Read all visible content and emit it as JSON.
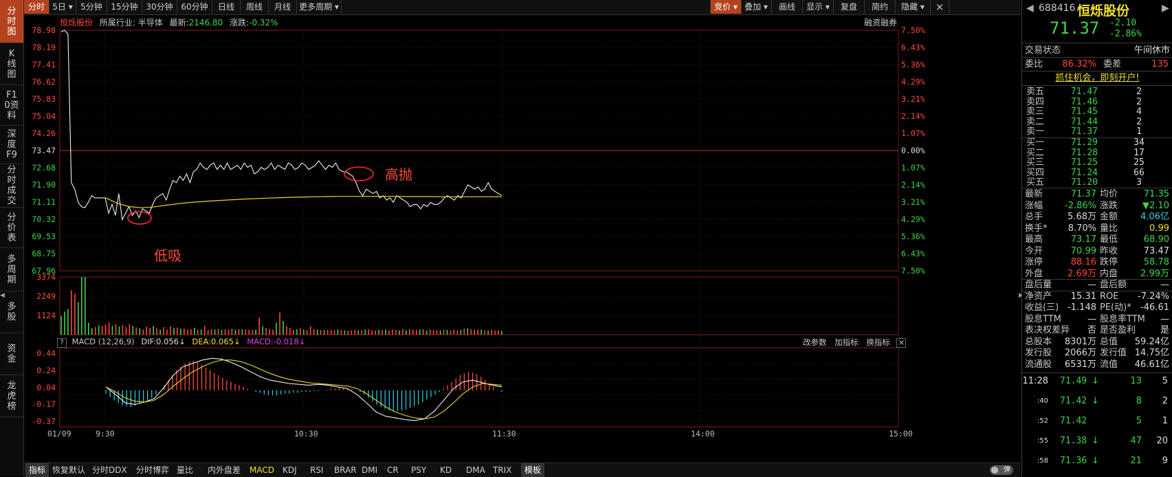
{
  "left_tabs": [
    "分时图",
    "K线图",
    "F10资料",
    "深度F9",
    "分时成交",
    "分价表",
    "多周期",
    "多股",
    "资金",
    "龙虎榜"
  ],
  "toolbar": {
    "periods": [
      "分时",
      "5日",
      "5分钟",
      "15分钟",
      "30分钟",
      "60分钟",
      "日线",
      "周线",
      "月线",
      "更多周期"
    ],
    "right_tools": [
      "竞价",
      "叠加",
      "画线",
      "显示",
      "复盘",
      "简约",
      "隐藏"
    ],
    "dropdown_glyph": "▾",
    "close_glyph": "×"
  },
  "chart_header": {
    "stock_name": "恒烁股份",
    "industry_label": "所属行业:",
    "industry": "半导体",
    "latest_label": "最新:",
    "latest": "2146.80",
    "change_label": "涨跌:",
    "change": "-0.32%",
    "margin_label": "融资融券"
  },
  "annotations": {
    "low_buy": "低吸",
    "high_sell": "高抛"
  },
  "macd_header": {
    "help": "?",
    "name": "MACD (12,26,9)",
    "dif": "DIF:0.056↓",
    "dea": "DEA:0.065↓",
    "macd": "MACD:-0.018↓",
    "modify": "改参数",
    "add": "加指标",
    "switch": "换指标",
    "close": "×"
  },
  "bottom_bar": {
    "indicator_tab": "指标",
    "items": [
      "恢复默认",
      "分时DDX",
      "分时博弈",
      "量比",
      "内外盘差",
      "MACD",
      "KDJ",
      "RSI",
      "BRAR",
      "DMI",
      "CR",
      "PSY",
      "KD",
      "DMA",
      "TRIX"
    ],
    "template_tab": "模板",
    "popup": "弹"
  },
  "chart_data": [
    {
      "type": "line",
      "name": "intraday_price",
      "x_ticks": [
        "01/09",
        "9:30",
        "10:30",
        "11:30",
        "14:00",
        "15:00"
      ],
      "price_ticks": [
        "78.98",
        "78.19",
        "77.41",
        "76.62",
        "75.83",
        "75.04",
        "74.26",
        "73.47",
        "72.68",
        "71.90",
        "71.11",
        "70.32",
        "69.53",
        "68.75",
        "67.96"
      ],
      "pct_ticks": [
        "7.50%",
        "6.43%",
        "5.36%",
        "4.29%",
        "3.21%",
        "2.14%",
        "1.07%",
        "0.00%",
        "1.07%",
        "2.14%",
        "3.21%",
        "4.29%",
        "5.36%",
        "6.43%",
        "7.50%"
      ],
      "ylim": [
        67.96,
        78.98
      ],
      "prev_close": 73.47,
      "series": [
        {
          "name": "price",
          "values": [
            78.9,
            78.98,
            78.8,
            72.0,
            71.7,
            71.1,
            70.9,
            70.85,
            71.1,
            71.4,
            71.3,
            71.3,
            71.3,
            71.3,
            70.6,
            71.0,
            70.5,
            71.5,
            70.3,
            70.6,
            70.9,
            70.5,
            70.7,
            70.4,
            70.8,
            70.7,
            70.6,
            71.0,
            71.3,
            71.4,
            71.5,
            71.2,
            71.7,
            72.1,
            72.0,
            72.3,
            72.1,
            72.4,
            72.0,
            72.5,
            72.6,
            72.9,
            72.7,
            72.6,
            72.8,
            72.9,
            72.6,
            72.8,
            72.6,
            72.9,
            72.6,
            72.7,
            72.8,
            72.6,
            72.9,
            72.7,
            72.8,
            72.4,
            72.5,
            72.7,
            72.6,
            72.7,
            72.9,
            72.6,
            72.8,
            72.7,
            72.6,
            72.9,
            72.8,
            72.6,
            72.7,
            72.9,
            72.8,
            72.6,
            72.7,
            72.8,
            73.0,
            72.8,
            72.6,
            72.8,
            72.7,
            72.9,
            72.6,
            72.5,
            72.5,
            72.4,
            72.3,
            72.0,
            71.6,
            71.4,
            71.7,
            71.6,
            71.5,
            71.6,
            71.3,
            71.4,
            71.2,
            71.3,
            71.1,
            71.4,
            71.3,
            71.2,
            71.1,
            70.9,
            71.0,
            71.0,
            70.8,
            71.0,
            70.9,
            71.1,
            71.0,
            71.0,
            71.1,
            71.3,
            71.4,
            71.3,
            71.2,
            71.4,
            71.3,
            71.6,
            71.9,
            71.8,
            71.7,
            71.8,
            71.6,
            71.7,
            72.0,
            71.7,
            71.6,
            71.5,
            71.4
          ]
        },
        {
          "name": "avg_price",
          "values": [
            71.3,
            71.05,
            70.9,
            70.85,
            70.88,
            70.95,
            71.02,
            71.08,
            71.12,
            71.16,
            71.19,
            71.22,
            71.25,
            71.27,
            71.29,
            71.31,
            71.33,
            71.34,
            71.35,
            71.36,
            71.37,
            71.37,
            71.37,
            71.37,
            71.37,
            71.37,
            71.36,
            71.36,
            71.36,
            71.35,
            71.35,
            71.35,
            71.35,
            71.35,
            71.35
          ]
        }
      ]
    },
    {
      "type": "bar",
      "name": "volume",
      "y_ticks": [
        "3374",
        "2249",
        "1124"
      ],
      "ylim": [
        0,
        3374
      ],
      "values": [
        1100,
        1350,
        1500,
        2600,
        2400,
        1900,
        3374,
        3374,
        700,
        380,
        450,
        550,
        520,
        600,
        720,
        520,
        620,
        480,
        560,
        450,
        640,
        520,
        420,
        380,
        300,
        460,
        400,
        520,
        380,
        300,
        440,
        300,
        500,
        380,
        420,
        350,
        360,
        300,
        320,
        400,
        280,
        300,
        520,
        260,
        320,
        300,
        340,
        280,
        310,
        300,
        360,
        280,
        320,
        330,
        300,
        290,
        260,
        300,
        1000,
        500,
        400,
        330,
        300,
        700,
        1300,
        800,
        500,
        400,
        280,
        320,
        380,
        300,
        260,
        480,
        330,
        300,
        270,
        260,
        300,
        260,
        260,
        300,
        280,
        260,
        240,
        260,
        280,
        250,
        260,
        300,
        330,
        260,
        250,
        280,
        260,
        290,
        240,
        300,
        280,
        250,
        340,
        260,
        320,
        280,
        260,
        300,
        320,
        240,
        300,
        280,
        260,
        250,
        300,
        280,
        260,
        310,
        240,
        280,
        360,
        380,
        320,
        290,
        300,
        300,
        260,
        250,
        280,
        250,
        260,
        220
      ],
      "colors": "mixed red/green"
    },
    {
      "type": "bar",
      "name": "macd",
      "y_ticks": [
        "0.44",
        "0.24",
        "0.04",
        "-0.17",
        "-0.37"
      ],
      "ylim": [
        -0.37,
        0.44
      ],
      "histogram": [
        -0.04,
        -0.08,
        -0.12,
        -0.15,
        -0.18,
        -0.19,
        -0.2,
        -0.18,
        -0.16,
        -0.14,
        -0.12,
        -0.09,
        -0.05,
        0.0,
        0.06,
        0.12,
        0.18,
        0.24,
        0.28,
        0.32,
        0.34,
        0.35,
        0.33,
        0.3,
        0.27,
        0.24,
        0.21,
        0.18,
        0.15,
        0.12,
        0.1,
        0.08,
        0.06,
        0.04,
        0.02,
        0.0,
        -0.02,
        -0.03,
        -0.05,
        -0.06,
        -0.06,
        -0.06,
        -0.05,
        -0.04,
        -0.04,
        -0.03,
        -0.03,
        -0.02,
        -0.02,
        -0.02,
        -0.01,
        -0.01,
        0.0,
        0.01,
        0.02,
        0.02,
        0.03,
        0.02,
        0.02,
        0.01,
        0.0,
        -0.02,
        -0.05,
        -0.09,
        -0.13,
        -0.17,
        -0.2,
        -0.22,
        -0.24,
        -0.25,
        -0.25,
        -0.24,
        -0.23,
        -0.21,
        -0.19,
        -0.17,
        -0.14,
        -0.11,
        -0.08,
        -0.05,
        -0.02,
        0.02,
        0.06,
        0.1,
        0.14,
        0.18,
        0.2,
        0.22,
        0.21,
        0.19,
        0.16,
        0.12,
        0.08,
        0.04,
        0.0,
        -0.02
      ],
      "series": [
        {
          "name": "DIF",
          "values": [
            0.04,
            -0.05,
            -0.15,
            -0.17,
            -0.14,
            -0.1,
            0.03,
            0.18,
            0.28,
            0.32,
            0.36,
            0.38,
            0.37,
            0.33,
            0.28,
            0.22,
            0.16,
            0.12,
            0.1,
            0.08,
            0.07,
            0.06,
            0.07,
            0.06,
            0.04,
            0.02,
            -0.05,
            -0.15,
            -0.26,
            -0.31,
            -0.33,
            -0.35,
            -0.36,
            -0.34,
            -0.25,
            -0.12,
            0.02,
            0.1,
            0.12,
            0.09,
            0.06,
            0.04
          ]
        },
        {
          "name": "DEA",
          "values": [
            0.04,
            -0.02,
            -0.09,
            -0.13,
            -0.14,
            -0.12,
            -0.05,
            0.05,
            0.14,
            0.22,
            0.28,
            0.33,
            0.36,
            0.36,
            0.34,
            0.3,
            0.25,
            0.2,
            0.16,
            0.13,
            0.11,
            0.09,
            0.08,
            0.07,
            0.06,
            0.05,
            0.02,
            -0.04,
            -0.12,
            -0.2,
            -0.26,
            -0.3,
            -0.33,
            -0.34,
            -0.32,
            -0.25,
            -0.15,
            -0.04,
            0.04,
            0.08,
            0.07,
            0.06
          ]
        }
      ]
    }
  ],
  "quote_panel": {
    "code": "688416",
    "name": "恒烁股份",
    "price": "71.37",
    "change": "-2.10",
    "change_pct": "-2.86%",
    "status_label": "交易状态",
    "status": "午间休市",
    "ratio_label": "委比",
    "ratio": "86.32%",
    "diff_label": "委差",
    "diff": "135",
    "promo": "抓住机会，即刻开户!",
    "asks": [
      {
        "label": "卖五",
        "price": "71.47",
        "vol": "2"
      },
      {
        "label": "卖四",
        "price": "71.46",
        "vol": "2"
      },
      {
        "label": "卖三",
        "price": "71.45",
        "vol": "4"
      },
      {
        "label": "卖二",
        "price": "71.44",
        "vol": "2"
      },
      {
        "label": "卖一",
        "price": "71.37",
        "vol": "1"
      }
    ],
    "bids": [
      {
        "label": "买一",
        "price": "71.29",
        "vol": "34"
      },
      {
        "label": "买二",
        "price": "71.28",
        "vol": "17"
      },
      {
        "label": "买三",
        "price": "71.25",
        "vol": "25"
      },
      {
        "label": "买四",
        "price": "71.24",
        "vol": "66"
      },
      {
        "label": "买五",
        "price": "71.20",
        "vol": "3"
      }
    ],
    "stats": [
      {
        "l1": "最新",
        "v1": "71.37",
        "c1": "g",
        "l2": "均价",
        "v2": "71.35",
        "c2": "g"
      },
      {
        "l1": "涨幅",
        "v1": "-2.86%",
        "c1": "g",
        "l2": "涨跌",
        "v2": "▼2.10",
        "c2": "g"
      },
      {
        "l1": "总手",
        "v1": "5.68万",
        "c1": "w",
        "l2": "金额",
        "v2": "4.06亿",
        "c2": "c"
      },
      {
        "l1": "换手*",
        "v1": "8.70%",
        "c1": "w",
        "l2": "量比",
        "v2": "0.99",
        "c2": "y"
      },
      {
        "l1": "最高",
        "v1": "73.17",
        "c1": "g",
        "l2": "最低",
        "v2": "68.90",
        "c2": "g"
      },
      {
        "l1": "今开",
        "v1": "70.99",
        "c1": "g",
        "l2": "昨收",
        "v2": "73.47",
        "c2": "w"
      },
      {
        "l1": "涨停",
        "v1": "88.16",
        "c1": "r",
        "l2": "跌停",
        "v2": "58.78",
        "c2": "g"
      },
      {
        "l1": "外盘",
        "v1": "2.69万",
        "c1": "r",
        "l2": "内盘",
        "v2": "2.99万",
        "c2": "g"
      },
      {
        "l1": "盘后量",
        "v1": "—",
        "c1": "w",
        "l2": "盘后额",
        "v2": "—",
        "c2": "w"
      },
      {
        "l1": "净资产",
        "v1": "15.31",
        "c1": "w",
        "l2": "ROE",
        "v2": "-7.24%",
        "c2": "w"
      },
      {
        "l1": "收益(三)",
        "v1": "-1.148",
        "c1": "w",
        "l2": "PE(动)*",
        "v2": "-46.61",
        "c2": "w"
      },
      {
        "l1": "股息TTM",
        "v1": "—",
        "c1": "w",
        "l2": "股息率TTM",
        "v2": "—",
        "c2": "w"
      },
      {
        "l1": "表决权差异",
        "v1": "否",
        "c1": "w",
        "l2": "是否盈利",
        "v2": "是",
        "c2": "w"
      },
      {
        "l1": "总股本",
        "v1": "8301万",
        "c1": "w",
        "l2": "总值",
        "v2": "59.24亿",
        "c2": "w"
      },
      {
        "l1": "发行股",
        "v1": "2066万",
        "c1": "w",
        "l2": "发行值",
        "v2": "14.75亿",
        "c2": "w"
      },
      {
        "l1": "流通股",
        "v1": "6531万",
        "c1": "w",
        "l2": "流值",
        "v2": "46.61亿",
        "c2": "w"
      }
    ],
    "ticks": [
      {
        "time": "11:28",
        "price": "71.49",
        "arrow": "↓",
        "vol": "13",
        "n": "5"
      },
      {
        "time": ":40",
        "price": "71.42",
        "arrow": "↓",
        "vol": "8",
        "n": "2"
      },
      {
        "time": ":52",
        "price": "71.42",
        "arrow": "",
        "vol": "5",
        "n": "1"
      },
      {
        "time": ":55",
        "price": "71.38",
        "arrow": "↓",
        "vol": "47",
        "n": "20"
      },
      {
        "time": ":58",
        "price": "71.36",
        "arrow": "↓",
        "vol": "21",
        "n": "9"
      }
    ]
  }
}
